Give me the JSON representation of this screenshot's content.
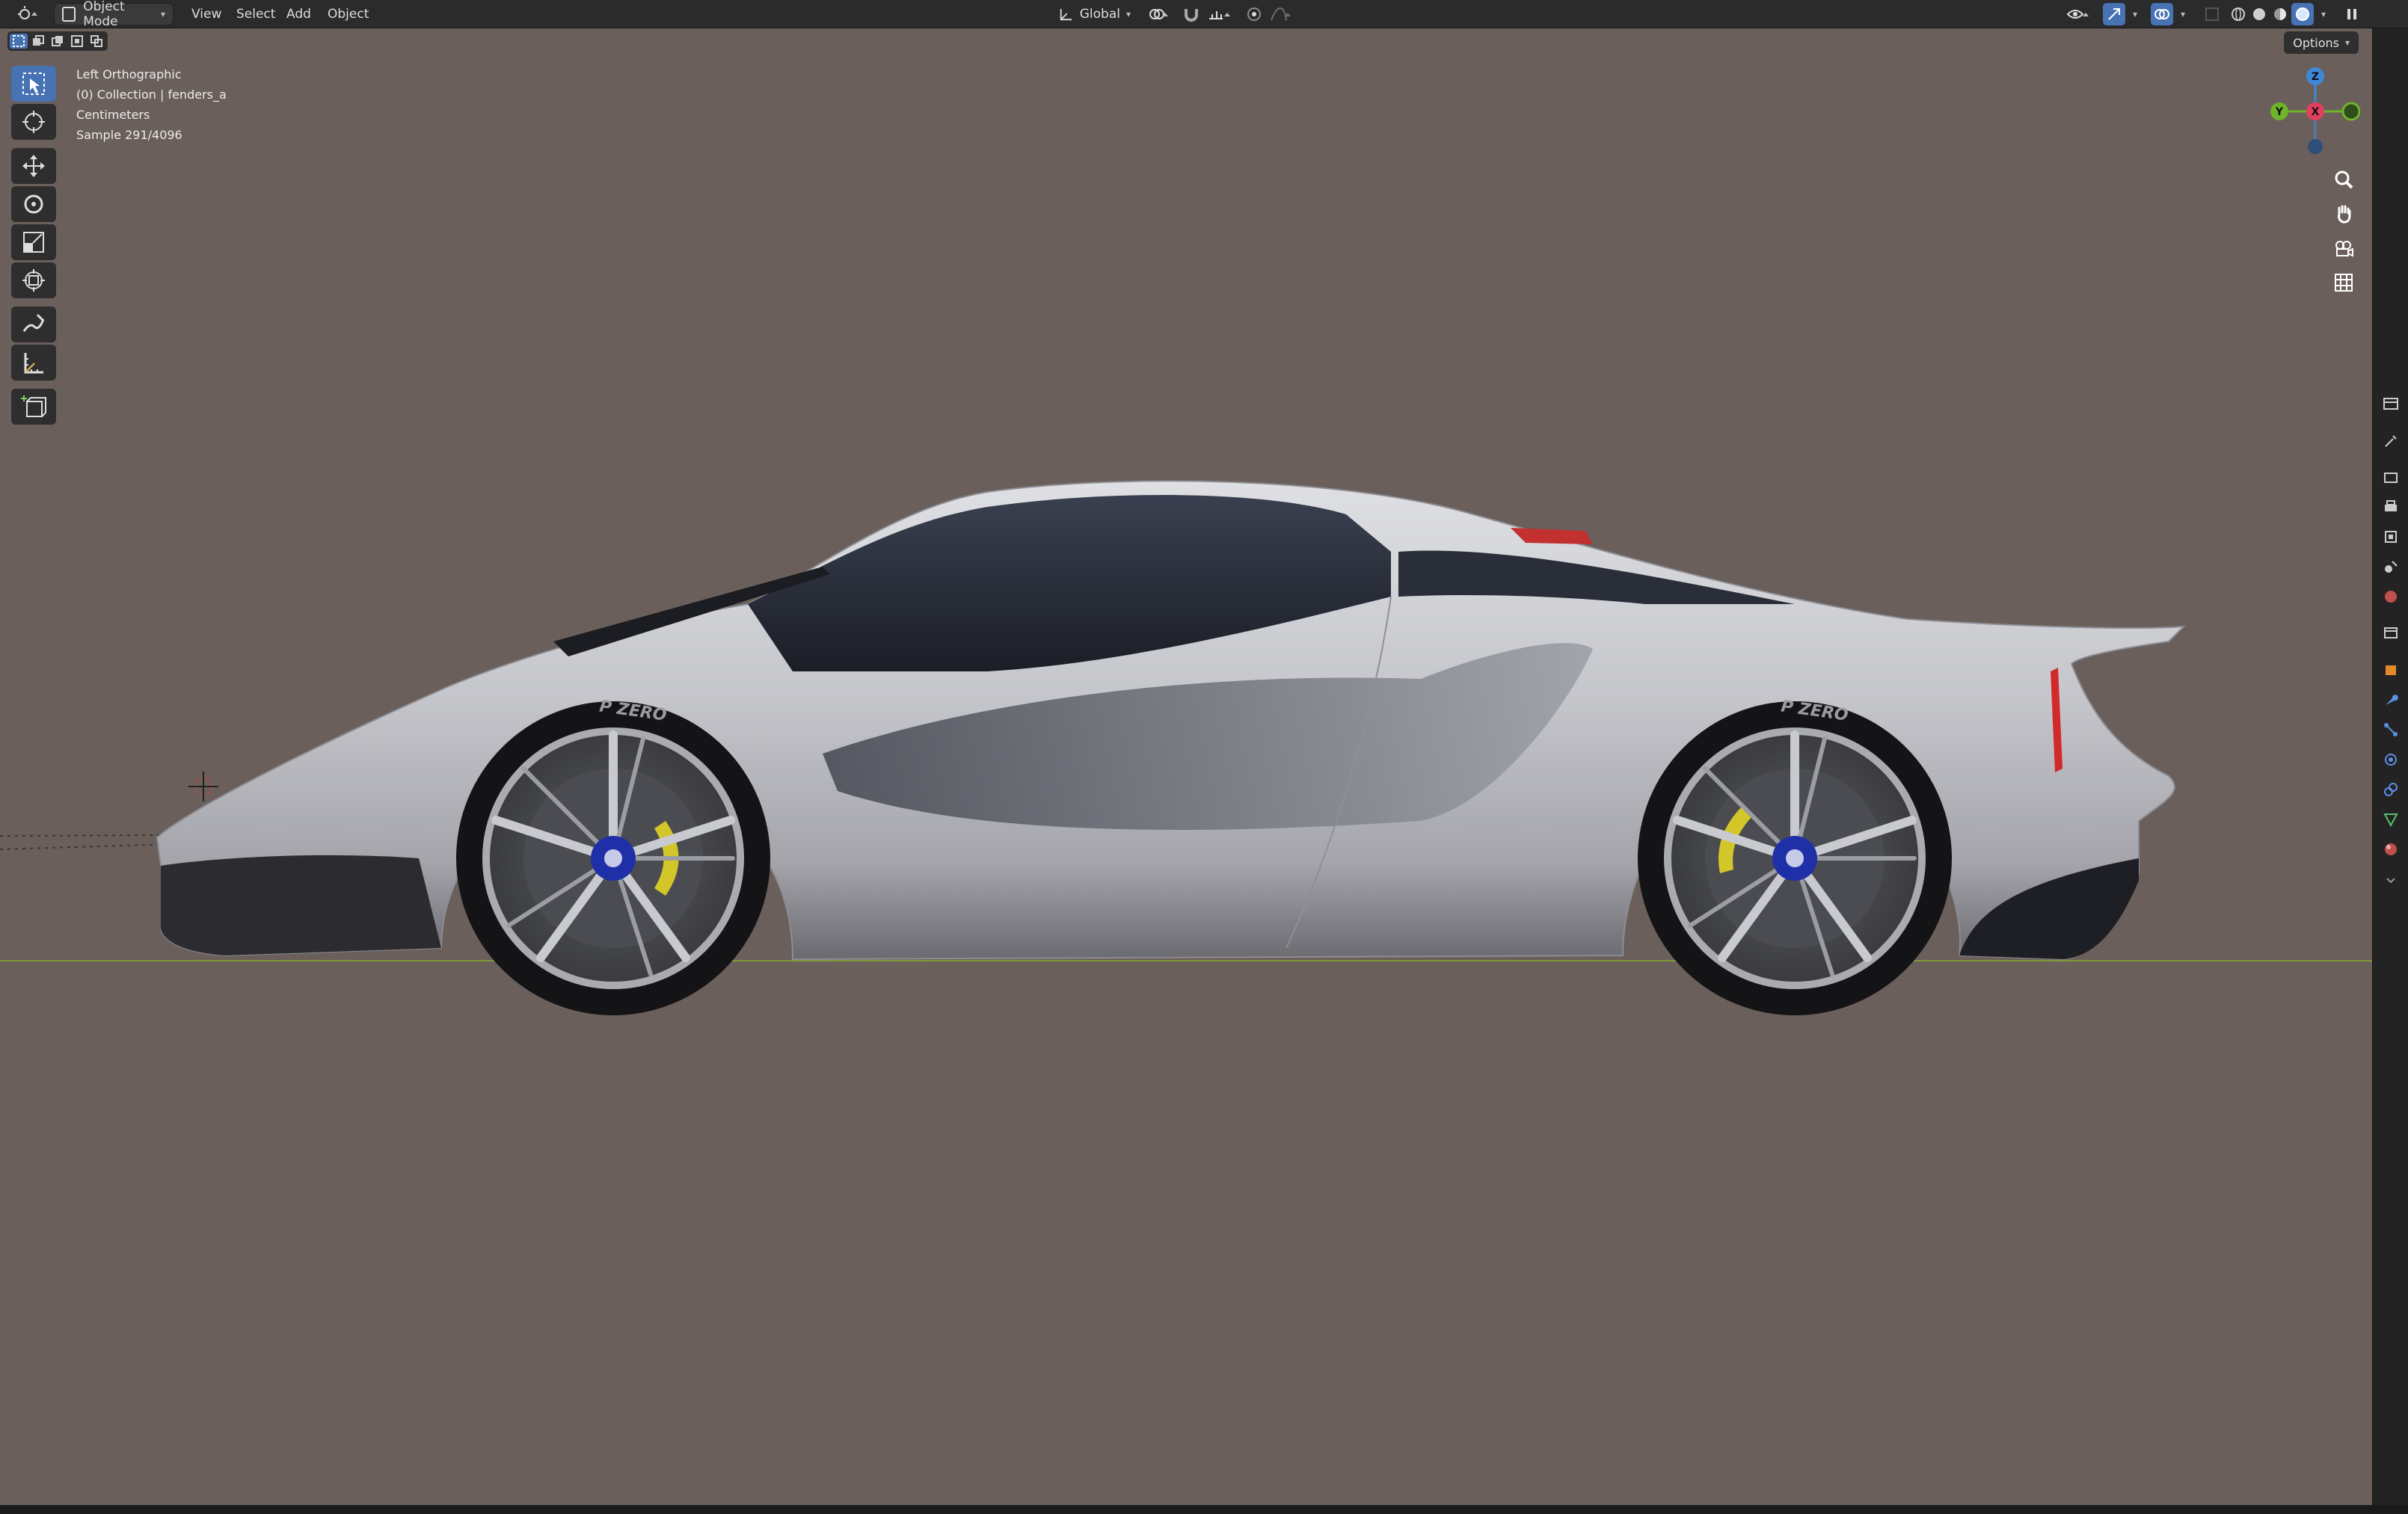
{
  "header": {
    "mode_label": "Object Mode",
    "menus": [
      "View",
      "Select",
      "Add",
      "Object"
    ],
    "transform_orientation": "Global"
  },
  "viewport": {
    "view_name": "Left Orthographic",
    "collection_info": "(0) Collection | fenders_a",
    "units": "Centimeters",
    "sample_info": "Sample 291/4096",
    "options_label": "Options",
    "background_color": "#6a5f5a"
  },
  "gizmo": {
    "axis_z": "Z",
    "axis_y": "Y",
    "axis_x": "X"
  },
  "tire_text": "P ZERO",
  "colors": {
    "accent": "#4772b3",
    "axis_x": "#e0405e",
    "axis_y": "#6fb42a",
    "axis_z": "#3f88d8",
    "car_body": "#c9c9cd",
    "caliper": "#d2c628",
    "hub": "#1f2fa8"
  },
  "icons": {
    "editor_type": "viewport-editor-icon",
    "tools": [
      "select-box-icon",
      "cursor-icon",
      "move-icon",
      "rotate-icon",
      "scale-icon",
      "transform-icon",
      "annotate-icon",
      "measure-icon",
      "add-cube-icon"
    ],
    "nav": [
      "zoom-icon",
      "pan-hand-icon",
      "camera-icon",
      "grid-icon"
    ]
  }
}
